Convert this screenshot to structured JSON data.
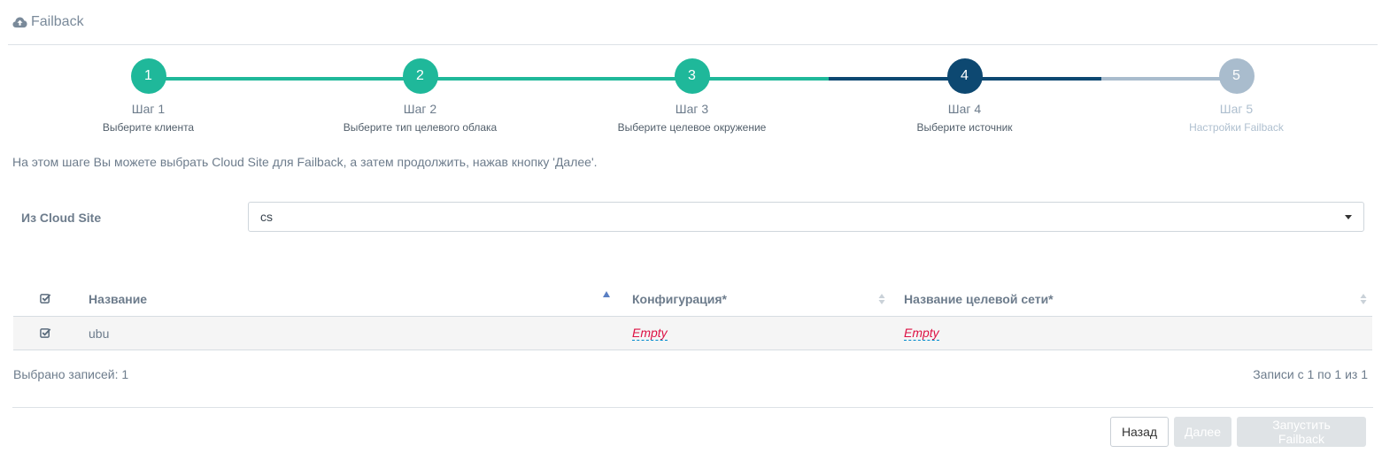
{
  "header": {
    "title": "Failback",
    "icon": "cloud-upload-icon"
  },
  "wizard": {
    "steps": [
      {
        "number": "1",
        "title": "Шаг 1",
        "desc": "Выберите клиента",
        "state": "done"
      },
      {
        "number": "2",
        "title": "Шаг 2",
        "desc": "Выберите тип целевого облака",
        "state": "done"
      },
      {
        "number": "3",
        "title": "Шаг 3",
        "desc": "Выберите целевое окружение",
        "state": "done"
      },
      {
        "number": "4",
        "title": "Шаг 4",
        "desc": "Выберите источник",
        "state": "active"
      },
      {
        "number": "5",
        "title": "Шаг 5",
        "desc": "Настройки Failback",
        "state": "future"
      }
    ],
    "colors": {
      "done": "#1fb89a",
      "active": "#0d4871",
      "future": "#a9bccd"
    }
  },
  "hint": "На этом шаге Вы можете выбрать Cloud Site для Failback, а затем продолжить, нажав кнопку 'Далее'.",
  "form": {
    "label": "Из Cloud Site",
    "selected": "cs"
  },
  "table": {
    "columns": [
      {
        "label": "Название",
        "sort": "asc"
      },
      {
        "label": "Конфигурация*",
        "sort": "none"
      },
      {
        "label": "Название целевой сети*",
        "sort": "none"
      }
    ],
    "rows": [
      {
        "checked": true,
        "name": "ubu",
        "config": "Empty",
        "network": "Empty"
      }
    ]
  },
  "footer": {
    "selected": "Выбрано записей: 1",
    "records": "Записи с 1 по 1 из 1",
    "back_label": "Назад",
    "next_label": "Далее",
    "run_label": "Запустить Failback"
  }
}
